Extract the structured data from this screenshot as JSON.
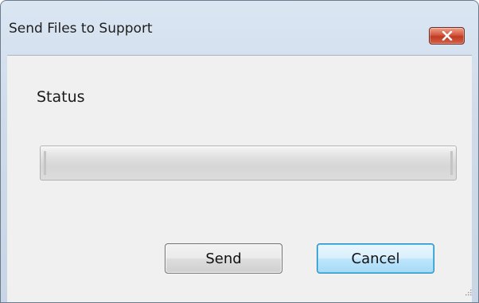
{
  "window": {
    "title": "Send Files to Support"
  },
  "status": {
    "label": "Status"
  },
  "progress": {
    "value": 0
  },
  "buttons": {
    "send_label": "Send",
    "cancel_label": "Cancel"
  },
  "icons": {
    "close": "close-icon",
    "grip": "resize-grip-icon"
  },
  "colors": {
    "close_button": "#d5563e",
    "focused_button_border": "#3c7fb1",
    "dialog_background": "#f0f0f0"
  }
}
